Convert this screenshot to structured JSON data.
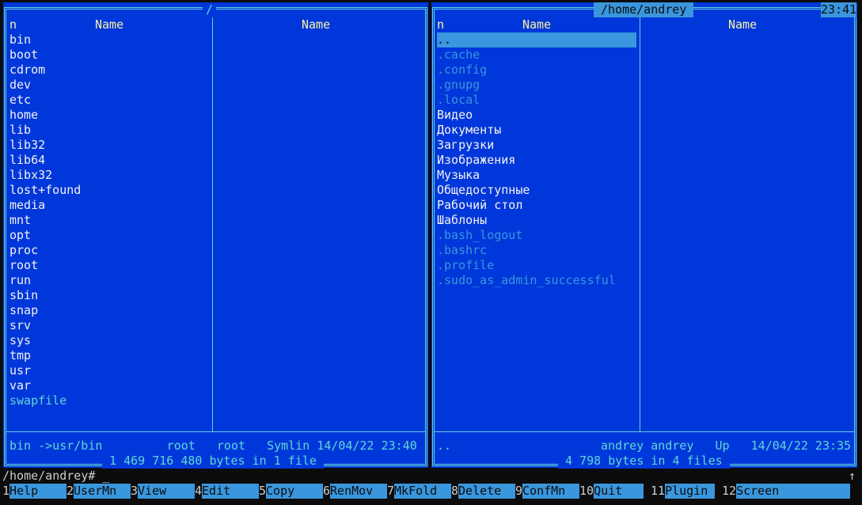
{
  "clock": "23:41",
  "left": {
    "path": "/",
    "col_n": "n",
    "col_name1": "Name",
    "col_name2": "Name",
    "files": [
      {
        "name": "bin"
      },
      {
        "name": "boot"
      },
      {
        "name": "cdrom"
      },
      {
        "name": "dev"
      },
      {
        "name": "etc"
      },
      {
        "name": "home"
      },
      {
        "name": "lib"
      },
      {
        "name": "lib32"
      },
      {
        "name": "lib64"
      },
      {
        "name": "libx32"
      },
      {
        "name": "lost+found"
      },
      {
        "name": "media"
      },
      {
        "name": "mnt"
      },
      {
        "name": "opt"
      },
      {
        "name": "proc"
      },
      {
        "name": "root"
      },
      {
        "name": "run"
      },
      {
        "name": "sbin"
      },
      {
        "name": "snap"
      },
      {
        "name": "srv"
      },
      {
        "name": "sys"
      },
      {
        "name": "tmp"
      },
      {
        "name": "usr"
      },
      {
        "name": "var"
      },
      {
        "name": "swapfile",
        "kind": "cy"
      }
    ],
    "info": "bin ->usr/bin         root   root   Symlin 14/04/22 23:40",
    "total": " 1 469 716 480 bytes in 1 file "
  },
  "right": {
    "path": "/home/andrey",
    "col_n": "n",
    "col_name1": "Name",
    "col_name2": "Name",
    "files": [
      {
        "name": "..",
        "kind": "sel"
      },
      {
        "name": ".cache",
        "kind": "hid"
      },
      {
        "name": ".config",
        "kind": "hid"
      },
      {
        "name": ".gnupg",
        "kind": "hid"
      },
      {
        "name": ".local",
        "kind": "hid"
      },
      {
        "name": "Видео"
      },
      {
        "name": "Документы"
      },
      {
        "name": "Загрузки"
      },
      {
        "name": "Изображения"
      },
      {
        "name": "Музыка"
      },
      {
        "name": "Общедоступные"
      },
      {
        "name": "Рабочий стол"
      },
      {
        "name": "Шаблоны"
      },
      {
        "name": ".bash_logout",
        "kind": "hid"
      },
      {
        "name": ".bashrc",
        "kind": "hid"
      },
      {
        "name": ".profile",
        "kind": "hid"
      },
      {
        "name": ".sudo_as_admin_successful",
        "kind": "hid"
      }
    ],
    "info_left": "..",
    "info_right": "andrey andrey   Up   14/04/22 23:35",
    "total": " 4 798 bytes in 4 files "
  },
  "cmdline": {
    "prompt": "/home/andrey# _",
    "scroll_icon": "↑"
  },
  "keys": [
    {
      "n": "1",
      "l": "Help"
    },
    {
      "n": "2",
      "l": "UserMn"
    },
    {
      "n": "3",
      "l": "View"
    },
    {
      "n": "4",
      "l": "Edit"
    },
    {
      "n": "5",
      "l": "Copy"
    },
    {
      "n": "6",
      "l": "RenMov"
    },
    {
      "n": "7",
      "l": "MkFold"
    },
    {
      "n": "8",
      "l": "Delete"
    },
    {
      "n": "9",
      "l": "ConfMn"
    },
    {
      "n": "10",
      "l": "Quit"
    },
    {
      "n": "11",
      "l": "Plugin"
    },
    {
      "n": "12",
      "l": "Screen"
    }
  ]
}
